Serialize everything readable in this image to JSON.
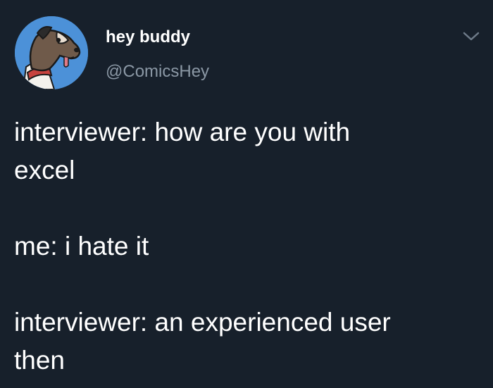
{
  "tweet": {
    "display_name": "hey buddy",
    "handle": "@ComicsHey",
    "lines": [
      "interviewer: how are you with",
      "excel",
      "me: i hate it",
      "interviewer: an experienced user",
      "then"
    ]
  },
  "icons": {
    "avatar": "cartoon-dog-avatar",
    "menu": "chevron-down-icon"
  },
  "colors": {
    "background": "#17202b",
    "primary_text": "#ffffff",
    "secondary_text": "#8b98a5",
    "avatar_background": "#4c91d8"
  }
}
